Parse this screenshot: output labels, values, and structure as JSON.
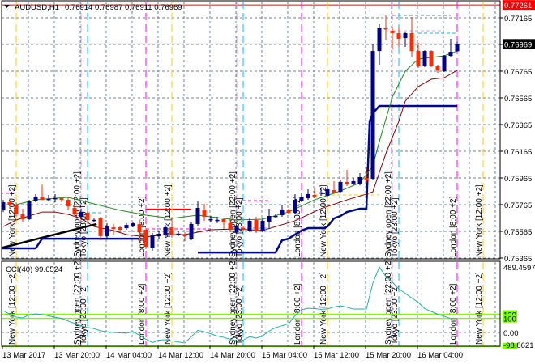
{
  "header": {
    "symbol": "AUDUSD,H1",
    "ohlc": "0.76914 0.76987 0.76911 0.76969"
  },
  "indicator": {
    "label": "CCI(40) 99.6524"
  },
  "colors": {
    "bull": "#00008b",
    "bear": "#ff2a00",
    "ma_fast": "#1a8c1a",
    "ma_slow": "#8b0000",
    "step_line": "#000a8c",
    "trend_line": "#000000",
    "cci_line": "#20b2aa",
    "cci_levels": "#7cfc00",
    "grid": "#708090",
    "high_line": "#ff0000",
    "new_york": "#ffc800",
    "sydney": "#dda0dd",
    "tokyo": "#00bfff",
    "london": "#ff00ff"
  },
  "chart_data": [
    {
      "type": "candlestick",
      "title": "AUDUSD,H1",
      "timeframe": "H1",
      "ylim": [
        0.75365,
        0.77261
      ],
      "y_ticks": [
        "0.77165",
        "0.76965",
        "0.76765",
        "0.76565",
        "0.76365",
        "0.76165",
        "0.75965",
        "0.75765",
        "0.75565",
        "0.75365"
      ],
      "price_labels": {
        "high_line": "0.77261",
        "current": "0.76969"
      },
      "high_line_value": 0.77261,
      "current_price": 0.76969,
      "x_tick_labels": [
        {
          "bar": 0,
          "label": "13 Mar 2017"
        },
        {
          "bar": 8,
          "label": "13 Mar 20:00"
        },
        {
          "bar": 16,
          "label": "14 Mar 04:00"
        },
        {
          "bar": 24,
          "label": "14 Mar 12:00"
        },
        {
          "bar": 32,
          "label": "14 Mar 20:00"
        },
        {
          "bar": 40,
          "label": "15 Mar 04:00"
        },
        {
          "bar": 48,
          "label": "15 Mar 12:00"
        },
        {
          "bar": 56,
          "label": "15 Mar 20:00"
        },
        {
          "bar": 64,
          "label": "16 Mar 04:00"
        }
      ],
      "candles_ohlc": [
        [
          0.75723,
          0.75801,
          0.7571,
          0.75783
        ],
        [
          0.75783,
          0.75813,
          0.75735,
          0.75759
        ],
        [
          0.75765,
          0.75783,
          0.75674,
          0.75692
        ],
        [
          0.75692,
          0.75735,
          0.75638,
          0.75656
        ],
        [
          0.75656,
          0.75801,
          0.7565,
          0.75789
        ],
        [
          0.75795,
          0.75844,
          0.75783,
          0.75826
        ],
        [
          0.75826,
          0.75916,
          0.75801,
          0.75801
        ],
        [
          0.75807,
          0.75838,
          0.75789,
          0.75808
        ],
        [
          0.75813,
          0.75844,
          0.75783,
          0.75814
        ],
        [
          0.75813,
          0.75826,
          0.75783,
          0.75801
        ],
        [
          0.75801,
          0.7582,
          0.75723,
          0.75753
        ],
        [
          0.75741,
          0.75759,
          0.75674,
          0.75692
        ],
        [
          0.75674,
          0.75735,
          0.75668,
          0.7571
        ],
        [
          0.75704,
          0.75723,
          0.75632,
          0.7565
        ],
        [
          0.7565,
          0.75662,
          0.75638,
          0.75651
        ],
        [
          0.75662,
          0.75674,
          0.75498,
          0.75529
        ],
        [
          0.75529,
          0.75626,
          0.7551,
          0.75601
        ],
        [
          0.75595,
          0.7562,
          0.75541,
          0.75583
        ],
        [
          0.75595,
          0.75607,
          0.75559,
          0.75577
        ],
        [
          0.75589,
          0.75626,
          0.75577,
          0.75613
        ],
        [
          0.75607,
          0.75638,
          0.75595,
          0.75626
        ],
        [
          0.7562,
          0.75644,
          0.7548,
          0.75559
        ],
        [
          0.75577,
          0.75589,
          0.75432,
          0.7545
        ],
        [
          0.75438,
          0.75553,
          0.7542,
          0.75535
        ],
        [
          0.75529,
          0.75571,
          0.75504,
          0.75547
        ],
        [
          0.75535,
          0.75613,
          0.75523,
          0.75595
        ],
        [
          0.75595,
          0.75662,
          0.75517,
          0.75541
        ],
        [
          0.75547,
          0.75571,
          0.75529,
          0.75548
        ],
        [
          0.75541,
          0.75559,
          0.75492,
          0.75529
        ],
        [
          0.7551,
          0.75638,
          0.75498,
          0.7562
        ],
        [
          0.7562,
          0.75789,
          0.75607,
          0.75741
        ],
        [
          0.75729,
          0.75771,
          0.75644,
          0.75674
        ],
        [
          0.75656,
          0.7568,
          0.75632,
          0.75657
        ],
        [
          0.7565,
          0.75674,
          0.75626,
          0.75651
        ],
        [
          0.75656,
          0.75662,
          0.75583,
          0.75632
        ],
        [
          0.75626,
          0.75662,
          0.75559,
          0.75583
        ],
        [
          0.75559,
          0.75613,
          0.75547,
          0.75601
        ],
        [
          0.75589,
          0.75601,
          0.75565,
          0.75577
        ],
        [
          0.75571,
          0.75662,
          0.75559,
          0.75644
        ],
        [
          0.7565,
          0.75674,
          0.75553,
          0.75565
        ],
        [
          0.75565,
          0.75662,
          0.75559,
          0.75644
        ],
        [
          0.75638,
          0.75735,
          0.75583,
          0.7568
        ],
        [
          0.7568,
          0.75698,
          0.75662,
          0.75681
        ],
        [
          0.75686,
          0.75765,
          0.75674,
          0.75729
        ],
        [
          0.75723,
          0.75735,
          0.75692,
          0.75704
        ],
        [
          0.75704,
          0.75844,
          0.75692,
          0.75801
        ],
        [
          0.75795,
          0.75856,
          0.75783,
          0.7582
        ],
        [
          0.75813,
          0.7588,
          0.75801,
          0.75844
        ],
        [
          0.75838,
          0.75886,
          0.75813,
          0.75826
        ],
        [
          0.75856,
          0.75892,
          0.75832,
          0.75857
        ],
        [
          0.75832,
          0.75904,
          0.7582,
          0.7588
        ],
        [
          0.75874,
          0.75941,
          0.75844,
          0.75856
        ],
        [
          0.75862,
          0.75953,
          0.7585,
          0.75935
        ],
        [
          0.75935,
          0.76026,
          0.75904,
          0.75916
        ],
        [
          0.75923,
          0.75965,
          0.7591,
          0.75941
        ],
        [
          0.75923,
          0.76001,
          0.7591,
          0.75971
        ],
        [
          0.75965,
          0.76044,
          0.75929,
          0.75947
        ],
        [
          0.75959,
          0.76965,
          0.75947,
          0.76916
        ],
        [
          0.76916,
          0.77116,
          0.76813,
          0.77086
        ],
        [
          0.77086,
          0.77183,
          0.76995,
          0.7708
        ],
        [
          0.77068,
          0.77098,
          0.76935,
          0.7705
        ],
        [
          0.7705,
          0.77098,
          0.76947,
          0.77007
        ],
        [
          0.77013,
          0.77056,
          0.76947,
          0.7705
        ],
        [
          0.7705,
          0.77171,
          0.76874,
          0.76916
        ],
        [
          0.76916,
          0.76977,
          0.76789,
          0.76801
        ],
        [
          0.76801,
          0.76922,
          0.76795,
          0.76916
        ],
        [
          0.76916,
          0.76922,
          0.76795,
          0.76801
        ],
        [
          0.76801,
          0.76813,
          0.76753,
          0.76771
        ],
        [
          0.76765,
          0.76886,
          0.76759,
          0.7688
        ],
        [
          0.7688,
          0.77007,
          0.76874,
          0.7691
        ],
        [
          0.76914,
          0.76987,
          0.76911,
          0.76969
        ]
      ],
      "ma_fast": [
        [
          2,
          0.75765
        ],
        [
          5,
          0.75801
        ],
        [
          10,
          0.7582
        ],
        [
          13,
          0.75783
        ],
        [
          18,
          0.75723
        ],
        [
          22,
          0.75686
        ],
        [
          26,
          0.75662
        ],
        [
          30,
          0.75686
        ],
        [
          36,
          0.7565
        ],
        [
          40,
          0.75656
        ],
        [
          44,
          0.7571
        ],
        [
          48,
          0.75801
        ],
        [
          52,
          0.75868
        ],
        [
          55,
          0.75929
        ],
        [
          57,
          0.76056
        ],
        [
          58,
          0.76238
        ],
        [
          60,
          0.76571
        ],
        [
          62,
          0.76765
        ],
        [
          64,
          0.76856
        ],
        [
          66,
          0.76868
        ],
        [
          68,
          0.7688
        ],
        [
          70,
          0.76916
        ]
      ],
      "ma_slow": [
        [
          0,
          0.75601
        ],
        [
          2,
          0.7565
        ],
        [
          4,
          0.7568
        ],
        [
          6,
          0.7571
        ],
        [
          8,
          0.7571
        ],
        [
          10,
          0.75692
        ],
        [
          12,
          0.75662
        ],
        [
          14,
          0.75601
        ],
        [
          17,
          0.75571
        ],
        [
          19,
          0.75541
        ],
        [
          22,
          0.75523
        ],
        [
          25,
          0.75541
        ],
        [
          28,
          0.75541
        ],
        [
          32,
          0.75577
        ],
        [
          36,
          0.75583
        ],
        [
          40,
          0.75571
        ],
        [
          45,
          0.75644
        ],
        [
          49,
          0.75735
        ],
        [
          53,
          0.75801
        ],
        [
          56,
          0.75844
        ],
        [
          57,
          0.75862
        ],
        [
          58,
          0.76007
        ],
        [
          59,
          0.76147
        ],
        [
          61,
          0.76389
        ],
        [
          62,
          0.76541
        ],
        [
          64,
          0.7665
        ],
        [
          66,
          0.76704
        ],
        [
          68,
          0.76716
        ],
        [
          70,
          0.76771
        ]
      ],
      "step_line_segments": [
        [
          [
            -0.5,
            0.75438
          ],
          [
            5,
            0.75438
          ],
          [
            6,
            0.7551
          ],
          [
            21,
            0.7551
          ]
        ],
        [
          [
            30,
            0.75407
          ],
          [
            42,
            0.75407
          ],
          [
            43,
            0.75498
          ],
          [
            44,
            0.7551
          ],
          [
            45,
            0.75541
          ],
          [
            46,
            0.75571
          ],
          [
            47,
            0.75589
          ],
          [
            49.5,
            0.75589
          ],
          [
            50,
            0.75601
          ],
          [
            51,
            0.75662
          ],
          [
            52,
            0.7568
          ],
          [
            53,
            0.7571
          ],
          [
            55,
            0.75735
          ],
          [
            56,
            0.75735
          ],
          [
            56.5,
            0.76389
          ],
          [
            57,
            0.7645
          ],
          [
            58,
            0.76504
          ],
          [
            70,
            0.76504
          ]
        ]
      ],
      "trend_line": [
        [
          -0.5,
          0.75438
        ],
        [
          14.4,
          0.7562
        ]
      ],
      "level_lines": [
        {
          "from": -0.5,
          "to": 2,
          "price": 0.7585,
          "color": "#ff00ff",
          "dashed": true
        },
        {
          "from": 22,
          "to": 29,
          "price": 0.75729,
          "color": "#ff0000",
          "dashed": false
        },
        {
          "from": 12,
          "to": 15,
          "price": 0.75704,
          "color": "#00bfff",
          "dashed": true
        },
        {
          "from": 22,
          "to": 32,
          "price": 0.75583,
          "color": "#ff00ff",
          "dashed": true
        },
        {
          "from": 35,
          "to": 41,
          "price": 0.75589,
          "color": "#00bfff",
          "dashed": true
        },
        {
          "from": 36,
          "to": 41,
          "price": 0.75795,
          "color": "#ff00ff",
          "dashed": true
        },
        {
          "from": 48,
          "to": 58,
          "price": 0.75838,
          "color": "#ffc800",
          "dashed": true
        },
        {
          "from": 60,
          "to": 69,
          "price": 0.77183,
          "color": "#708090",
          "dashed": true
        },
        {
          "from": 60,
          "to": 68,
          "price": 0.77068,
          "color": "#dda0dd",
          "dashed": true
        },
        {
          "from": 64,
          "to": 70,
          "price": 0.7705,
          "color": "#00bfff",
          "dashed": true
        }
      ],
      "sessions": [
        {
          "key": "new_york",
          "label": "New York  [12:00 +2]",
          "bars": [
            2,
            26,
            50,
            74
          ]
        },
        {
          "key": "sydney",
          "label": "Sydney  open  [22:00 +2]",
          "bars": [
            12,
            36,
            60
          ]
        },
        {
          "key": "tokyo",
          "label": "Tokyo  [23:00 +2]",
          "bars": [
            13,
            37,
            61
          ]
        },
        {
          "key": "london",
          "label": "London  [8:00 +2]",
          "bars": [
            22,
            46,
            70
          ]
        }
      ]
    },
    {
      "type": "line",
      "title": "CCI(40)",
      "value_label": "99.6524",
      "ylim": [
        -98.8621,
        489.4597
      ],
      "y_labels": [
        "489.4597",
        "130",
        "100",
        "0.00",
        "-98.8621"
      ],
      "levels": [
        130,
        100,
        -100
      ],
      "zero_line": 0,
      "values": [
        156,
        130,
        110,
        104,
        125,
        133,
        128,
        118,
        108,
        100,
        82,
        65,
        48,
        35,
        28,
        12,
        5,
        0,
        -3,
        -5,
        6,
        -20,
        -48,
        -72,
        -55,
        -52,
        -60,
        -68,
        -75,
        -30,
        15,
        5,
        -10,
        -25,
        -35,
        -48,
        -62,
        -55,
        -30,
        -40,
        -25,
        10,
        35,
        48,
        62,
        120,
        162,
        173,
        170,
        165,
        168,
        182,
        190,
        180,
        167,
        167,
        168,
        352,
        467,
        400,
        360,
        310,
        280,
        245,
        215,
        170,
        150,
        130,
        115,
        100,
        99.6524
      ]
    }
  ]
}
